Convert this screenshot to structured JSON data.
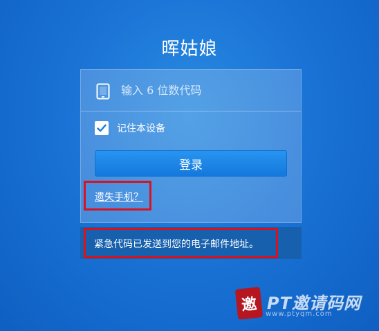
{
  "page": {
    "title": "晖姑娘"
  },
  "login_form": {
    "code_placeholder": "输入 6 位数代码",
    "code_value": "",
    "remember_label": "记住本设备",
    "remember_checked": true,
    "login_button": "登录",
    "lost_phone_link": "遗失手机？"
  },
  "notice": {
    "message": "紧急代码已发送到您的电子邮件地址。"
  },
  "watermark": {
    "seal_char": "邀",
    "text": "PT邀请码网",
    "url": "www.ptyqm.com"
  },
  "colors": {
    "background": "#1a73d6",
    "button": "#1c86e6",
    "banner": "#1660ad",
    "highlight": "#d9121f"
  }
}
